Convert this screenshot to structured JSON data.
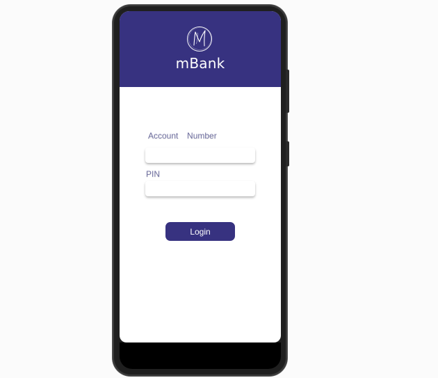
{
  "app": {
    "brand_name": "mBank",
    "brand_color": "#373280",
    "logo_icon": "m-monogram-logo"
  },
  "login_form": {
    "account_number_label": "Account  Number",
    "account_number_value": "",
    "pin_label": "PIN",
    "pin_value": "",
    "login_button_label": "Login"
  }
}
